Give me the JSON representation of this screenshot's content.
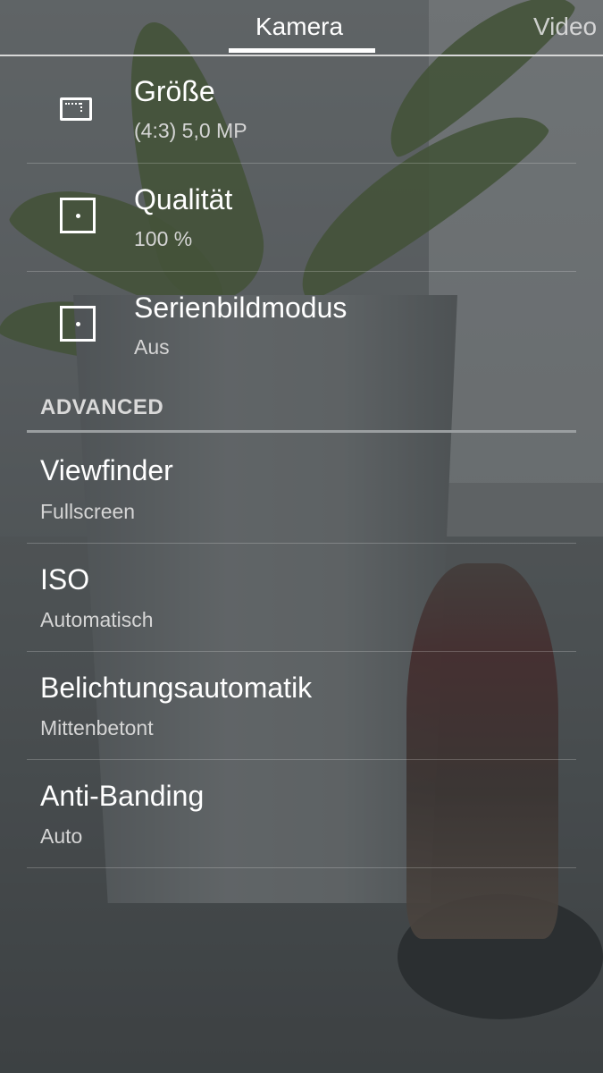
{
  "tabs": [
    {
      "label": "Kamera",
      "selected": true
    },
    {
      "label": "Video",
      "selected": false
    }
  ],
  "photo_settings": [
    {
      "title": "Größe",
      "value": "(4:3) 5,0 MP",
      "icon": "picture-size-icon"
    },
    {
      "title": "Qualität",
      "value": "100 %",
      "icon": "quality-icon"
    },
    {
      "title": "Serienbildmodus",
      "value": "Aus",
      "icon": "burst-mode-icon"
    }
  ],
  "advanced": {
    "header": "ADVANCED",
    "items": [
      {
        "title": "Viewfinder",
        "value": "Fullscreen"
      },
      {
        "title": "ISO",
        "value": "Automatisch"
      },
      {
        "title": "Belichtungsautomatik",
        "value": "Mittenbetont"
      },
      {
        "title": "Anti-Banding",
        "value": "Auto"
      }
    ]
  }
}
